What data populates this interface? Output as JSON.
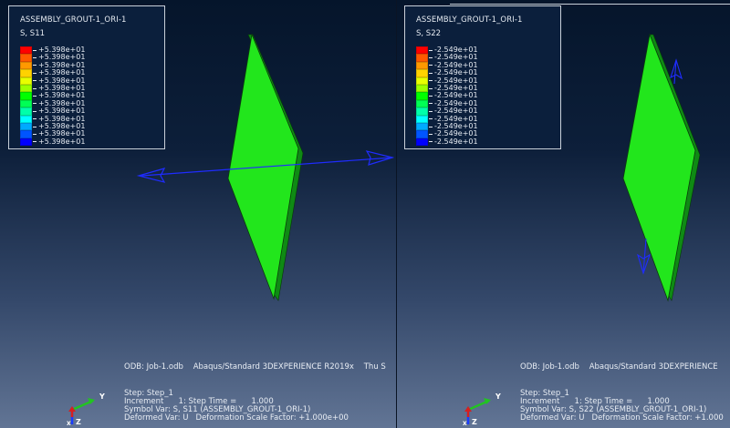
{
  "left_viewport": {
    "legend": {
      "title": "ASSEMBLY_GROUT-1_ORI-1",
      "variable": "S, S11",
      "values": [
        "+5.398e+01",
        "+5.398e+01",
        "+5.398e+01",
        "+5.398e+01",
        "+5.398e+01",
        "+5.398e+01",
        "+5.398e+01",
        "+5.398e+01",
        "+5.398e+01",
        "+5.398e+01",
        "+5.398e+01",
        "+5.398e+01",
        "+5.398e+01"
      ]
    },
    "odb_line": "ODB: Job-1.odb    Abaqus/Standard 3DEXPERIENCE R2019x    Thu S",
    "step": "Step: Step_1",
    "increment": "Increment      1: Step Time =      1.000",
    "symbol_var": "Symbol Var: S, S11 (ASSEMBLY_GROUT-1_ORI-1)",
    "deformed_var": "Deformed Var: U   Deformation Scale Factor: +1.000e+00",
    "triad": {
      "y": "Y",
      "z": "Z",
      "x": "X"
    }
  },
  "right_viewport": {
    "legend": {
      "title": "ASSEMBLY_GROUT-1_ORI-1",
      "variable": "S, S22",
      "values": [
        "-2.549e+01",
        "-2.549e+01",
        "-2.549e+01",
        "-2.549e+01",
        "-2.549e+01",
        "-2.549e+01",
        "-2.549e+01",
        "-2.549e+01",
        "-2.549e+01",
        "-2.549e+01",
        "-2.549e+01",
        "-2.549e+01",
        "-2.549e+01"
      ]
    },
    "odb_line": "ODB: Job-1.odb    Abaqus/Standard 3DEXPERIENCE",
    "step": "Step: Step_1",
    "increment": "Increment      1: Step Time =      1.000",
    "symbol_var": "Symbol Var: S, S22 (ASSEMBLY_GROUT-1_ORI-1)",
    "deformed_var": "Deformed Var: U   Deformation Scale Factor: +1.000",
    "triad": {
      "y": "Y",
      "z": "Z",
      "x": "X"
    }
  },
  "colors": {
    "contour": [
      "#ff0000",
      "#ff5a00",
      "#ff9900",
      "#ffd200",
      "#e8ff00",
      "#9cff00",
      "#00ff00",
      "#00ff55",
      "#00ffaa",
      "#00ffff",
      "#00aaff",
      "#0055ff",
      "#0000ff"
    ],
    "part_face": "#22e61c",
    "part_edge": "#0a3d0a",
    "arrow": "#1f2cff"
  }
}
